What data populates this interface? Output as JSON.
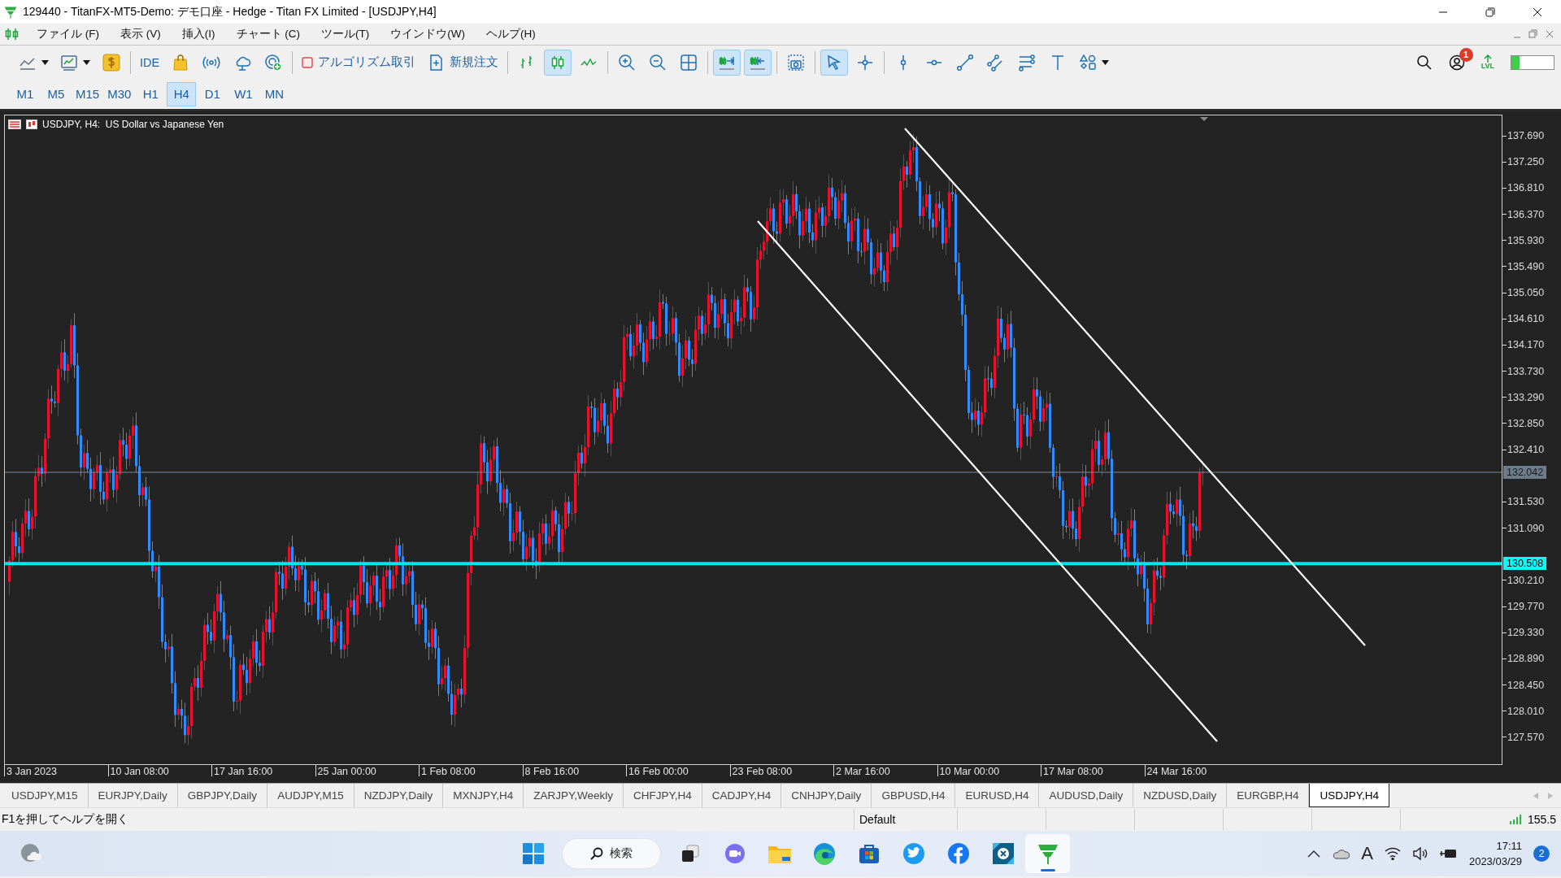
{
  "window": {
    "title": "129440 - TitanFX-MT5-Demo: デモ口座 - Hedge - Titan FX Limited - [USDJPY,H4]"
  },
  "menu": [
    "ファイル (F)",
    "表示 (V)",
    "挿入(I)",
    "チャート (C)",
    "ツール(T)",
    "ウインドウ(W)",
    "ヘルプ(H)"
  ],
  "toolbar": {
    "buttons": [
      {
        "selected": false
      },
      {
        "selected": false
      },
      {
        "selected": false
      },
      {
        "label": "IDE",
        "selected": false
      },
      {
        "selected": false
      },
      {
        "selected": false
      },
      {
        "selected": false
      },
      {
        "selected": false
      },
      {
        "label": "アルゴリズム取引",
        "selected": false
      },
      {
        "label": "新規注文",
        "selected": false
      },
      {
        "selected": false
      },
      {
        "selected": true
      },
      {
        "selected": false
      },
      {
        "selected": false
      },
      {
        "selected": false
      },
      {
        "selected": false
      },
      {
        "selected": true
      },
      {
        "selected": true
      },
      {
        "selected": false
      },
      {
        "selected": true
      },
      {
        "selected": false
      },
      {
        "selected": false
      },
      {
        "selected": false
      },
      {
        "selected": false
      },
      {
        "selected": false
      },
      {
        "selected": false
      },
      {
        "selected": false
      },
      {
        "selected": false
      }
    ],
    "account_badge": "1",
    "upgrade_label": "LVL",
    "level": 0.2
  },
  "timeframes": [
    {
      "label": "M1",
      "selected": false
    },
    {
      "label": "M5",
      "selected": false
    },
    {
      "label": "M15",
      "selected": false
    },
    {
      "label": "M30",
      "selected": false
    },
    {
      "label": "H1",
      "selected": false
    },
    {
      "label": "H4",
      "selected": true
    },
    {
      "label": "D1",
      "selected": false
    },
    {
      "label": "W1",
      "selected": false
    },
    {
      "label": "MN",
      "selected": false
    }
  ],
  "chart": {
    "symbol_label": "USDJPY, H4:  US Dollar vs Japanese Yen",
    "price_axis": [
      "137.690",
      "137.250",
      "136.810",
      "136.370",
      "135.930",
      "135.490",
      "135.050",
      "134.610",
      "134.170",
      "133.730",
      "133.290",
      "132.850",
      "132.410",
      "131.530",
      "131.090",
      "130.210",
      "129.770",
      "129.330",
      "128.890",
      "128.450",
      "128.010",
      "127.570"
    ],
    "bid_tag": "132.042",
    "line_tag": "130.508",
    "time_axis": [
      "3 Jan 2023",
      "10 Jan 08:00",
      "17 Jan 16:00",
      "25 Jan 00:00",
      "1 Feb 08:00",
      "8 Feb 16:00",
      "16 Feb 00:00",
      "23 Feb 08:00",
      "2 Mar 16:00",
      "10 Mar 00:00",
      "17 Mar 08:00",
      "24 Mar 16:00"
    ]
  },
  "symbol_tabs": [
    {
      "label": "USDJPY,M15",
      "selected": false
    },
    {
      "label": "EURJPY,Daily",
      "selected": false
    },
    {
      "label": "GBPJPY,Daily",
      "selected": false
    },
    {
      "label": "AUDJPY,M15",
      "selected": false
    },
    {
      "label": "NZDJPY,Daily",
      "selected": false
    },
    {
      "label": "MXNJPY,H4",
      "selected": false
    },
    {
      "label": "ZARJPY,Weekly",
      "selected": false
    },
    {
      "label": "CHFJPY,H4",
      "selected": false
    },
    {
      "label": "CADJPY,H4",
      "selected": false
    },
    {
      "label": "CNHJPY,Daily",
      "selected": false
    },
    {
      "label": "GBPUSD,H4",
      "selected": false
    },
    {
      "label": "EURUSD,H4",
      "selected": false
    },
    {
      "label": "AUDUSD,Daily",
      "selected": false
    },
    {
      "label": "NZDUSD,Daily",
      "selected": false
    },
    {
      "label": "EURGBP,H4",
      "selected": false
    },
    {
      "label": "USDJPY,H4",
      "selected": true
    }
  ],
  "status_bar": {
    "hint": "F1を押してヘルプを開く",
    "profile": "Default",
    "ping": "155.5"
  },
  "taskbar": {
    "search_label": "検索",
    "apps": [
      {
        "active": false
      },
      {
        "active": false
      },
      {
        "active": false
      },
      {
        "active": false
      },
      {
        "active": false
      },
      {
        "active": false
      },
      {
        "active": false
      },
      {
        "active": false
      },
      {
        "active": true
      }
    ],
    "ime": "A",
    "time": "17:11",
    "date": "2023/03/29",
    "notifications": "2"
  }
}
